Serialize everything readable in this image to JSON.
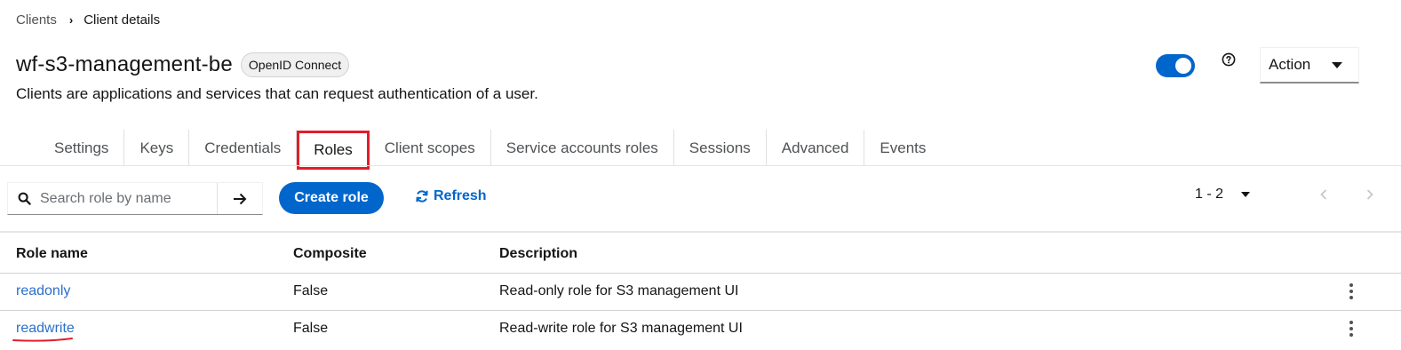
{
  "breadcrumb": {
    "parent": "Clients",
    "separator": "›",
    "current": "Client details"
  },
  "header": {
    "title": "wf-s3-management-be",
    "protocol_badge": "OpenID Connect",
    "subtitle": "Clients are applications and services that can request authentication of a user.",
    "enabled_toggle": true,
    "help_icon": "question-circle-icon",
    "action_label": "Action"
  },
  "tabs": [
    {
      "label": "Settings",
      "active": false
    },
    {
      "label": "Keys",
      "active": false
    },
    {
      "label": "Credentials",
      "active": false
    },
    {
      "label": "Roles",
      "active": true
    },
    {
      "label": "Client scopes",
      "active": false
    },
    {
      "label": "Service accounts roles",
      "active": false
    },
    {
      "label": "Sessions",
      "active": false
    },
    {
      "label": "Advanced",
      "active": false
    },
    {
      "label": "Events",
      "active": false
    }
  ],
  "toolbar": {
    "search_placeholder": "Search role by name",
    "create_label": "Create role",
    "refresh_label": "Refresh",
    "page_range": "1 - 2"
  },
  "table": {
    "columns": [
      "Role name",
      "Composite",
      "Description"
    ],
    "rows": [
      {
        "name": "readonly",
        "composite": "False",
        "description": "Read-only role for S3 management UI"
      },
      {
        "name": "readwrite",
        "composite": "False",
        "description": "Read-write role for S3 management UI"
      }
    ]
  },
  "colors": {
    "primary": "#0066cc",
    "link": "#2b6fc9",
    "highlight": "#e11d2b"
  }
}
